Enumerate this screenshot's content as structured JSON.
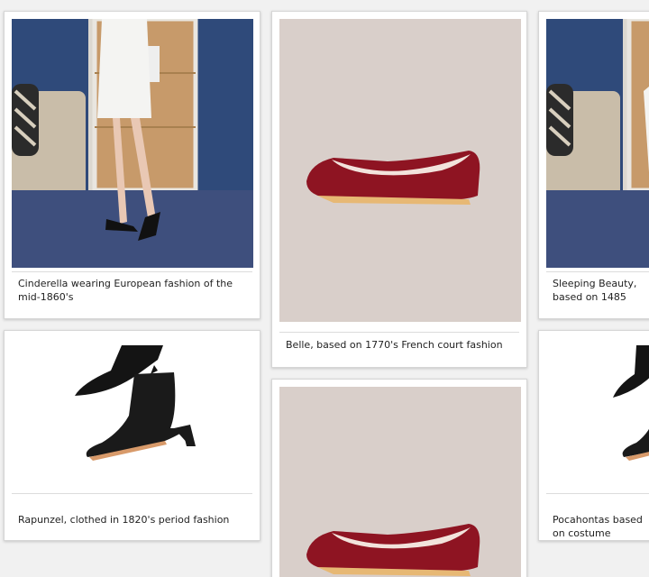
{
  "cards": [
    {
      "caption": "Cinderella wearing European fashion of the mid-1860's",
      "image": "woman-in-black-flats-photo"
    },
    {
      "caption": "Belle, based on 1770's French court fashion",
      "image": "red-suede-flat-shoe-photo"
    },
    {
      "caption": "Sleeping Beauty, based on 1485",
      "image": "woman-in-black-flats-photo"
    },
    {
      "caption": "Rapunzel, clothed in 1820's period fashion",
      "image": "black-ankle-boots-photo"
    },
    {
      "caption": "",
      "image": "red-suede-flat-shoe-photo"
    },
    {
      "caption": "Pocahontas based on costume",
      "image": "black-ankle-boots-photo"
    }
  ],
  "colors": {
    "card_bg": "#ffffff",
    "page_bg": "#f1f1f1",
    "suede_red": "#8e1422",
    "beige_backdrop": "#d9cfca",
    "curtain_blue": "#2f4a7a",
    "carpet_blue": "#3e4f7d"
  }
}
